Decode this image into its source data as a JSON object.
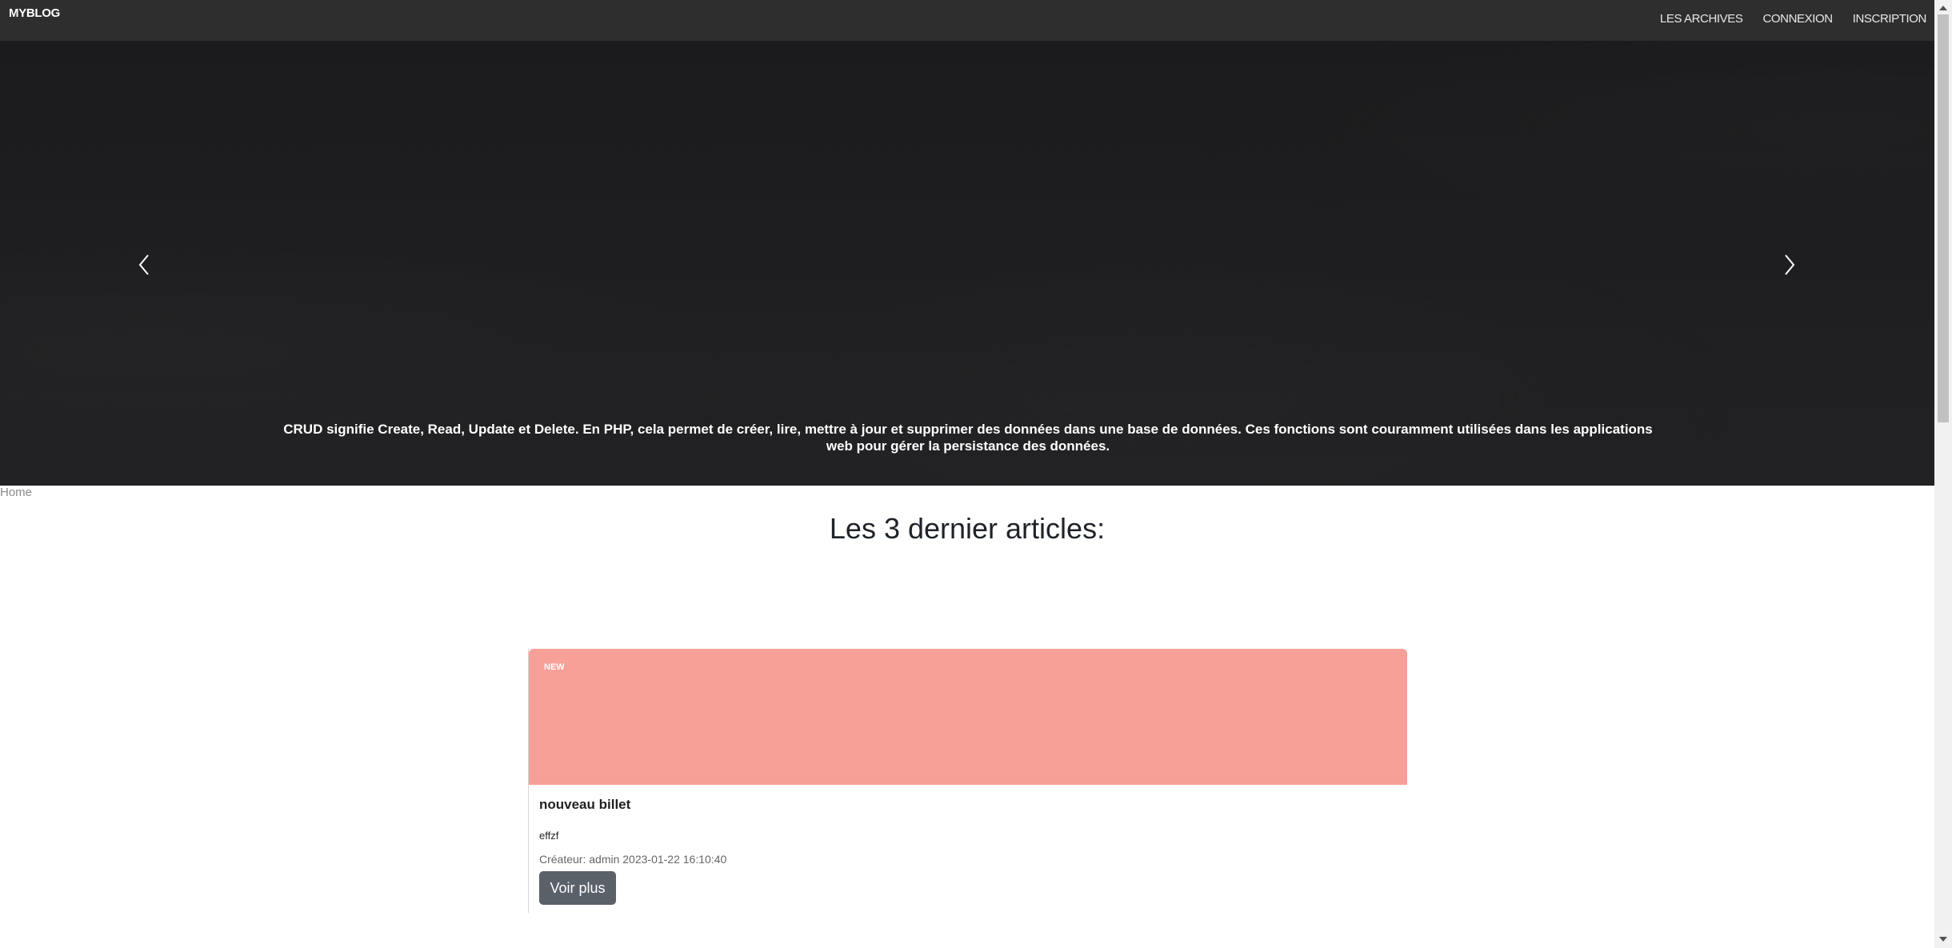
{
  "navbar": {
    "brand": "MYBLOG",
    "links": [
      "LES ARCHIVES",
      "CONNEXION",
      "INSCRIPTION"
    ]
  },
  "hero": {
    "caption": "CRUD signifie Create, Read, Update et Delete. En PHP, cela permet de créer, lire, mettre à jour et supprimer des données dans une base de données. Ces fonctions sont couramment utilisées dans les applications web pour gérer la persistance des données.",
    "prev_icon": "chevron-left-icon",
    "next_icon": "chevron-right-icon"
  },
  "breadcrumb": "Home",
  "section_title": "Les 3 dernier articles:",
  "articles": [
    {
      "badge": "NEW",
      "title": "nouveau billet",
      "text": "effzf",
      "meta": "Créateur: admin 2023-01-22 16:10:40",
      "button": "Voir plus",
      "image_color": "#f6a097"
    }
  ],
  "colors": {
    "navbar_bg": "#2e2e2e",
    "hero_bg": "#1e1e20",
    "button_bg": "#5a6169"
  }
}
